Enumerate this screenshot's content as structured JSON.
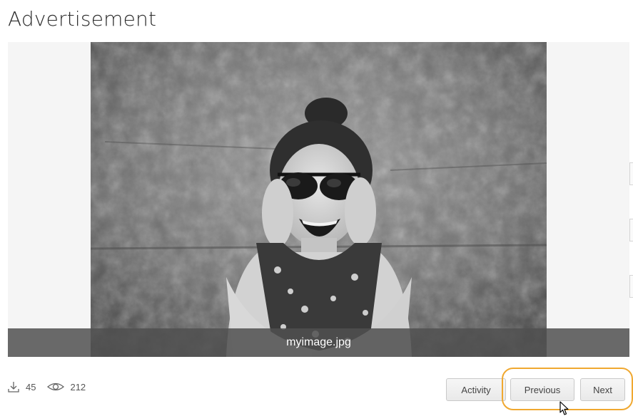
{
  "page": {
    "title": "Advertisement"
  },
  "viewer": {
    "filename": "myimage.jpg",
    "image_alt": "Black and white photo of a smiling woman in sunglasses holding her face in front of a textured wall"
  },
  "stats": {
    "downloads": "45",
    "views": "212",
    "download_icon": "download-icon",
    "views_icon": "eye-icon"
  },
  "actions": {
    "activity_label": "Activity",
    "previous_label": "Previous",
    "next_label": "Next"
  },
  "colors": {
    "highlight": "#f0a830",
    "caption_bg": "#505050"
  }
}
